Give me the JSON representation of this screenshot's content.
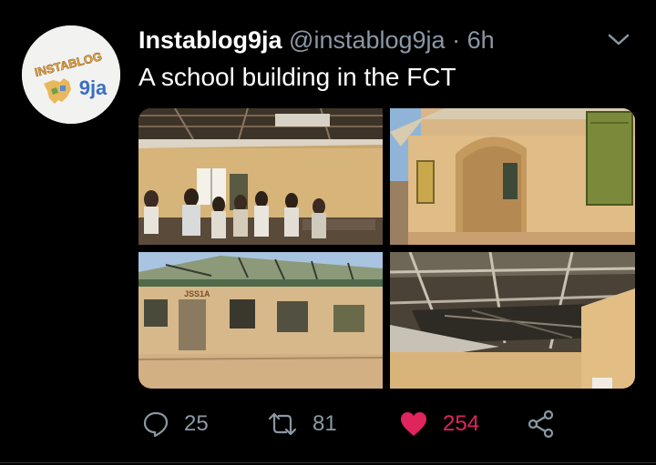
{
  "tweet": {
    "display_name": "Instablog9ja",
    "handle": "@instablog9ja",
    "separator": "·",
    "time": "6h",
    "text": "A school building in the FCT"
  },
  "avatar": {
    "logo_top": "INSTABLOG",
    "logo_bottom": "9ja"
  },
  "media": {
    "photos": [
      {
        "subject": "classroom-with-students"
      },
      {
        "subject": "building-exterior-doorway"
      },
      {
        "subject": "building-damaged-roof"
      },
      {
        "subject": "damaged-ceiling"
      }
    ],
    "signage": "JSS1A"
  },
  "actions": {
    "replies": "25",
    "retweets": "81",
    "likes": "254"
  },
  "colors": {
    "background": "#000000",
    "text": "#ffffff",
    "secondary": "#8b98a5",
    "like": "#e0245e"
  }
}
